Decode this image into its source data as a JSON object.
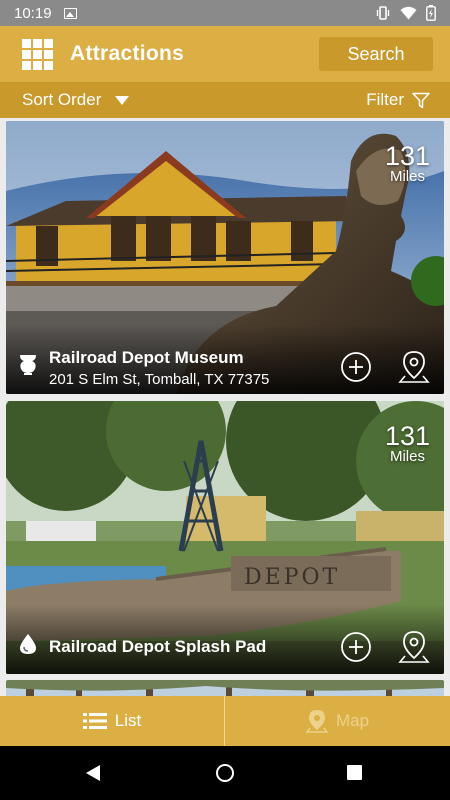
{
  "status_bar": {
    "time": "10:19",
    "icons": [
      "photo-icon",
      "vibrate-icon",
      "wifi-icon",
      "battery-icon"
    ]
  },
  "app_bar": {
    "menu_icon": "grid-menu-icon",
    "title": "Attractions",
    "search_label": "Search",
    "color": "#dcaf45"
  },
  "filter_bar": {
    "sort_label": "Sort Order",
    "filter_label": "Filter",
    "color": "#c9992c"
  },
  "attractions": [
    {
      "name": "Railroad Depot Museum",
      "address": "201 S Elm St, Tomball, TX 77375",
      "distance": "131",
      "distance_unit": "Miles",
      "category_icon": "museum-vase-icon"
    },
    {
      "name": "Railroad Depot Splash Pad",
      "address": "",
      "distance": "131",
      "distance_unit": "Miles",
      "category_icon": "water-drop-icon",
      "sign_text": "DEPOT"
    }
  ],
  "tabs": [
    {
      "label": "List",
      "icon": "list-icon",
      "active": true
    },
    {
      "label": "Map",
      "icon": "map-pin-icon",
      "active": false
    }
  ],
  "nav_bar": {
    "icons": [
      "back-icon",
      "home-icon",
      "recent-apps-icon"
    ]
  }
}
